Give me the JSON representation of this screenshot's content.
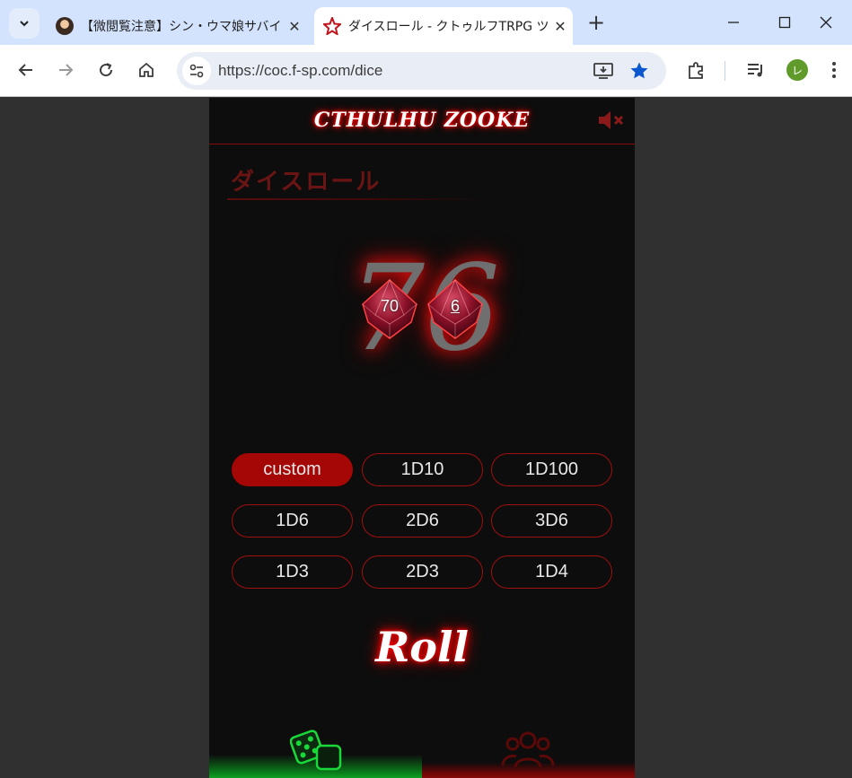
{
  "browser": {
    "tabs": [
      {
        "title": "【微閲覧注意】シン・ウマ娘サバイバ",
        "active": false
      },
      {
        "title": "ダイスロール - クトゥルフTRPG ツー",
        "active": true
      }
    ],
    "new_tab_label": "+",
    "url": "https://coc.f-sp.com/dice",
    "profile_initial": "レ",
    "accent_color": "#0b57d0"
  },
  "app": {
    "logo_text": "CTHULHU ZOOKE",
    "page_title": "ダイスロール",
    "result": "76",
    "dice": [
      {
        "label": "70",
        "kind": "d10-tens"
      },
      {
        "label": "6",
        "kind": "d10-ones"
      }
    ],
    "dice_buttons": [
      {
        "label": "custom",
        "selected": true
      },
      {
        "label": "1D10",
        "selected": false
      },
      {
        "label": "1D100",
        "selected": false
      },
      {
        "label": "1D6",
        "selected": false
      },
      {
        "label": "2D6",
        "selected": false
      },
      {
        "label": "3D6",
        "selected": false
      },
      {
        "label": "1D3",
        "selected": false
      },
      {
        "label": "2D3",
        "selected": false
      },
      {
        "label": "1D4",
        "selected": false
      }
    ],
    "roll_button": "Roll",
    "bottom_nav": [
      {
        "icon": "dice-icon",
        "active": true
      },
      {
        "icon": "users-icon",
        "active": false
      }
    ],
    "colors": {
      "primary_red": "#a50606",
      "nav_active_green": "#0fa022",
      "background": "#0d0d0d"
    }
  }
}
